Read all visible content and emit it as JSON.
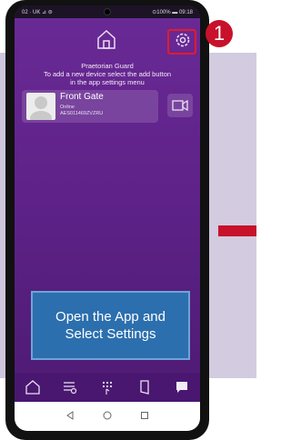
{
  "step": {
    "number": "1"
  },
  "status_bar": {
    "left": "02 · UK ⊿ ⊜",
    "right": "⊙100% ▬ 09:18"
  },
  "header": {
    "app_name": "Praetorian Guard",
    "hint_line1": "To add a new device select the add button",
    "hint_line2": "in the app settings menu"
  },
  "device": {
    "name": "Front Gate",
    "status": "Online",
    "id": "AES011469ZVZRU"
  },
  "instruction": "Open the App and Select Settings",
  "bottom_nav": [
    "home-icon",
    "device-list-icon",
    "keypad-icon",
    "door-icon",
    "message-icon"
  ],
  "system_nav": [
    "back-icon",
    "home-circle-icon",
    "recents-icon"
  ],
  "colors": {
    "accent_red": "#c8112a",
    "screen_purple": "#5e2288",
    "instruction_blue": "#2c6fae"
  }
}
